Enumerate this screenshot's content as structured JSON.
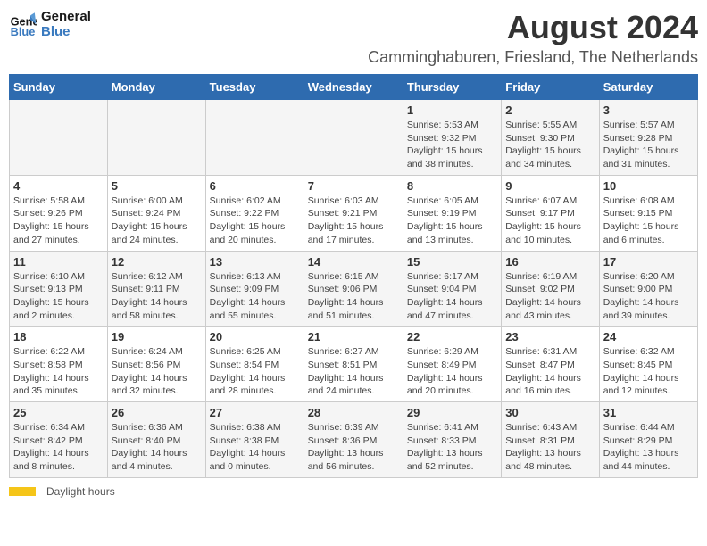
{
  "logo": {
    "line1": "General",
    "line2": "Blue",
    "icon_color": "#3a7abf"
  },
  "title": "August 2024",
  "subtitle": "Camminghaburen, Friesland, The Netherlands",
  "days_of_week": [
    "Sunday",
    "Monday",
    "Tuesday",
    "Wednesday",
    "Thursday",
    "Friday",
    "Saturday"
  ],
  "footer": {
    "daylight_label": "Daylight hours"
  },
  "weeks": [
    [
      {
        "day": "",
        "info": ""
      },
      {
        "day": "",
        "info": ""
      },
      {
        "day": "",
        "info": ""
      },
      {
        "day": "",
        "info": ""
      },
      {
        "day": "1",
        "info": "Sunrise: 5:53 AM\nSunset: 9:32 PM\nDaylight: 15 hours\nand 38 minutes."
      },
      {
        "day": "2",
        "info": "Sunrise: 5:55 AM\nSunset: 9:30 PM\nDaylight: 15 hours\nand 34 minutes."
      },
      {
        "day": "3",
        "info": "Sunrise: 5:57 AM\nSunset: 9:28 PM\nDaylight: 15 hours\nand 31 minutes."
      }
    ],
    [
      {
        "day": "4",
        "info": "Sunrise: 5:58 AM\nSunset: 9:26 PM\nDaylight: 15 hours\nand 27 minutes."
      },
      {
        "day": "5",
        "info": "Sunrise: 6:00 AM\nSunset: 9:24 PM\nDaylight: 15 hours\nand 24 minutes."
      },
      {
        "day": "6",
        "info": "Sunrise: 6:02 AM\nSunset: 9:22 PM\nDaylight: 15 hours\nand 20 minutes."
      },
      {
        "day": "7",
        "info": "Sunrise: 6:03 AM\nSunset: 9:21 PM\nDaylight: 15 hours\nand 17 minutes."
      },
      {
        "day": "8",
        "info": "Sunrise: 6:05 AM\nSunset: 9:19 PM\nDaylight: 15 hours\nand 13 minutes."
      },
      {
        "day": "9",
        "info": "Sunrise: 6:07 AM\nSunset: 9:17 PM\nDaylight: 15 hours\nand 10 minutes."
      },
      {
        "day": "10",
        "info": "Sunrise: 6:08 AM\nSunset: 9:15 PM\nDaylight: 15 hours\nand 6 minutes."
      }
    ],
    [
      {
        "day": "11",
        "info": "Sunrise: 6:10 AM\nSunset: 9:13 PM\nDaylight: 15 hours\nand 2 minutes."
      },
      {
        "day": "12",
        "info": "Sunrise: 6:12 AM\nSunset: 9:11 PM\nDaylight: 14 hours\nand 58 minutes."
      },
      {
        "day": "13",
        "info": "Sunrise: 6:13 AM\nSunset: 9:09 PM\nDaylight: 14 hours\nand 55 minutes."
      },
      {
        "day": "14",
        "info": "Sunrise: 6:15 AM\nSunset: 9:06 PM\nDaylight: 14 hours\nand 51 minutes."
      },
      {
        "day": "15",
        "info": "Sunrise: 6:17 AM\nSunset: 9:04 PM\nDaylight: 14 hours\nand 47 minutes."
      },
      {
        "day": "16",
        "info": "Sunrise: 6:19 AM\nSunset: 9:02 PM\nDaylight: 14 hours\nand 43 minutes."
      },
      {
        "day": "17",
        "info": "Sunrise: 6:20 AM\nSunset: 9:00 PM\nDaylight: 14 hours\nand 39 minutes."
      }
    ],
    [
      {
        "day": "18",
        "info": "Sunrise: 6:22 AM\nSunset: 8:58 PM\nDaylight: 14 hours\nand 35 minutes."
      },
      {
        "day": "19",
        "info": "Sunrise: 6:24 AM\nSunset: 8:56 PM\nDaylight: 14 hours\nand 32 minutes."
      },
      {
        "day": "20",
        "info": "Sunrise: 6:25 AM\nSunset: 8:54 PM\nDaylight: 14 hours\nand 28 minutes."
      },
      {
        "day": "21",
        "info": "Sunrise: 6:27 AM\nSunset: 8:51 PM\nDaylight: 14 hours\nand 24 minutes."
      },
      {
        "day": "22",
        "info": "Sunrise: 6:29 AM\nSunset: 8:49 PM\nDaylight: 14 hours\nand 20 minutes."
      },
      {
        "day": "23",
        "info": "Sunrise: 6:31 AM\nSunset: 8:47 PM\nDaylight: 14 hours\nand 16 minutes."
      },
      {
        "day": "24",
        "info": "Sunrise: 6:32 AM\nSunset: 8:45 PM\nDaylight: 14 hours\nand 12 minutes."
      }
    ],
    [
      {
        "day": "25",
        "info": "Sunrise: 6:34 AM\nSunset: 8:42 PM\nDaylight: 14 hours\nand 8 minutes."
      },
      {
        "day": "26",
        "info": "Sunrise: 6:36 AM\nSunset: 8:40 PM\nDaylight: 14 hours\nand 4 minutes."
      },
      {
        "day": "27",
        "info": "Sunrise: 6:38 AM\nSunset: 8:38 PM\nDaylight: 14 hours\nand 0 minutes."
      },
      {
        "day": "28",
        "info": "Sunrise: 6:39 AM\nSunset: 8:36 PM\nDaylight: 13 hours\nand 56 minutes."
      },
      {
        "day": "29",
        "info": "Sunrise: 6:41 AM\nSunset: 8:33 PM\nDaylight: 13 hours\nand 52 minutes."
      },
      {
        "day": "30",
        "info": "Sunrise: 6:43 AM\nSunset: 8:31 PM\nDaylight: 13 hours\nand 48 minutes."
      },
      {
        "day": "31",
        "info": "Sunrise: 6:44 AM\nSunset: 8:29 PM\nDaylight: 13 hours\nand 44 minutes."
      }
    ]
  ]
}
